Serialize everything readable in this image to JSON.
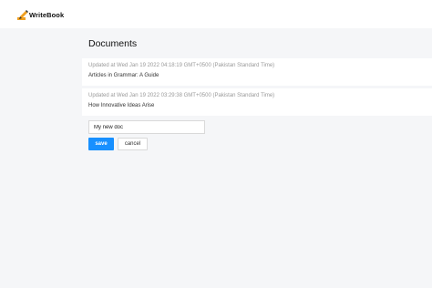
{
  "app": {
    "name": "WriteBook"
  },
  "page": {
    "title": "Documents"
  },
  "documents": [
    {
      "meta": "Updated at Wed Jan 19 2022 04:18:19 GMT+0500 (Pakistan Standard Time)",
      "title": "Articles in Grammar: A Guide"
    },
    {
      "meta": "Updated at Wed Jan 19 2022 03:29:38 GMT+0500 (Pakistan Standard Time)",
      "title": "How Innovative Ideas Arise"
    }
  ],
  "new_doc": {
    "value": "My new doc"
  },
  "actions": {
    "save_label": "save",
    "cancel_label": "cancel"
  },
  "colors": {
    "accent": "#1890ff",
    "logo_pencil": "#f0a020"
  }
}
